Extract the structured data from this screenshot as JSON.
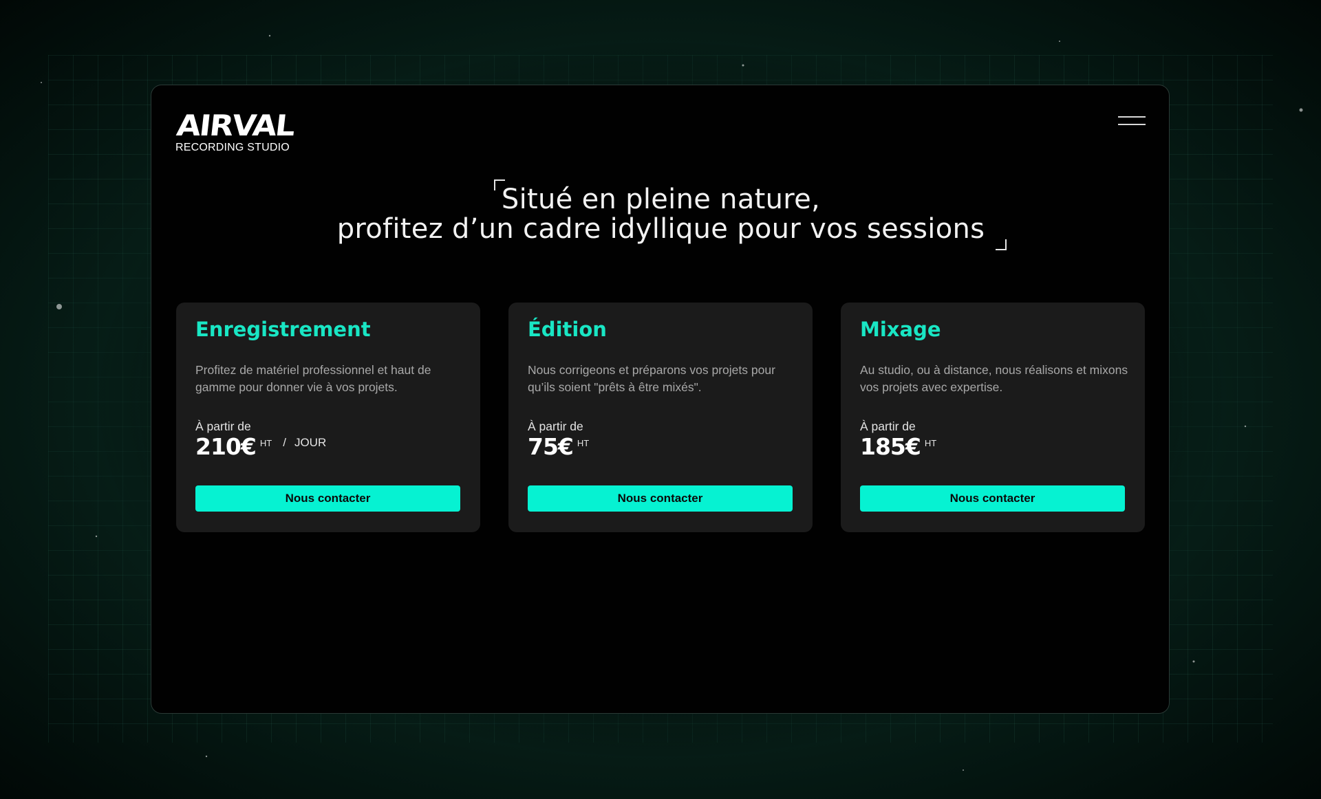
{
  "brand": {
    "name": "AIRVAL",
    "subtitle": "RECORDING STUDIO"
  },
  "header": {
    "menu_icon": "hamburger-menu-icon"
  },
  "hero": {
    "line1": "Situé en pleine nature,",
    "line2": "profitez d’un cadre idyllique pour vos sessions"
  },
  "services": [
    {
      "title": "Enregistrement",
      "description": "Profitez de matériel professionnel et haut de gamme pour donner vie à vos projets.",
      "from_label": "À partir de",
      "price": "210€",
      "tax": "HT",
      "separator": "/",
      "unit": "JOUR",
      "cta": "Nous contacter"
    },
    {
      "title": "Édition",
      "description": "Nous corrigeons et préparons vos projets pour qu’ils soient \"prêts à être mixés\".",
      "from_label": "À partir de",
      "price": "75€",
      "tax": "HT",
      "cta": "Nous contacter"
    },
    {
      "title": "Mixage",
      "description": "Au studio, ou à distance, nous réalisons et mixons vos projets avec expertise.",
      "from_label": "À partir de",
      "price": "185€",
      "tax": "HT",
      "cta": "Nous contacter"
    }
  ],
  "colors": {
    "accent": "#19e6c4",
    "button": "#06f2d2",
    "card": "#1b1b1b",
    "background": "#072019"
  }
}
